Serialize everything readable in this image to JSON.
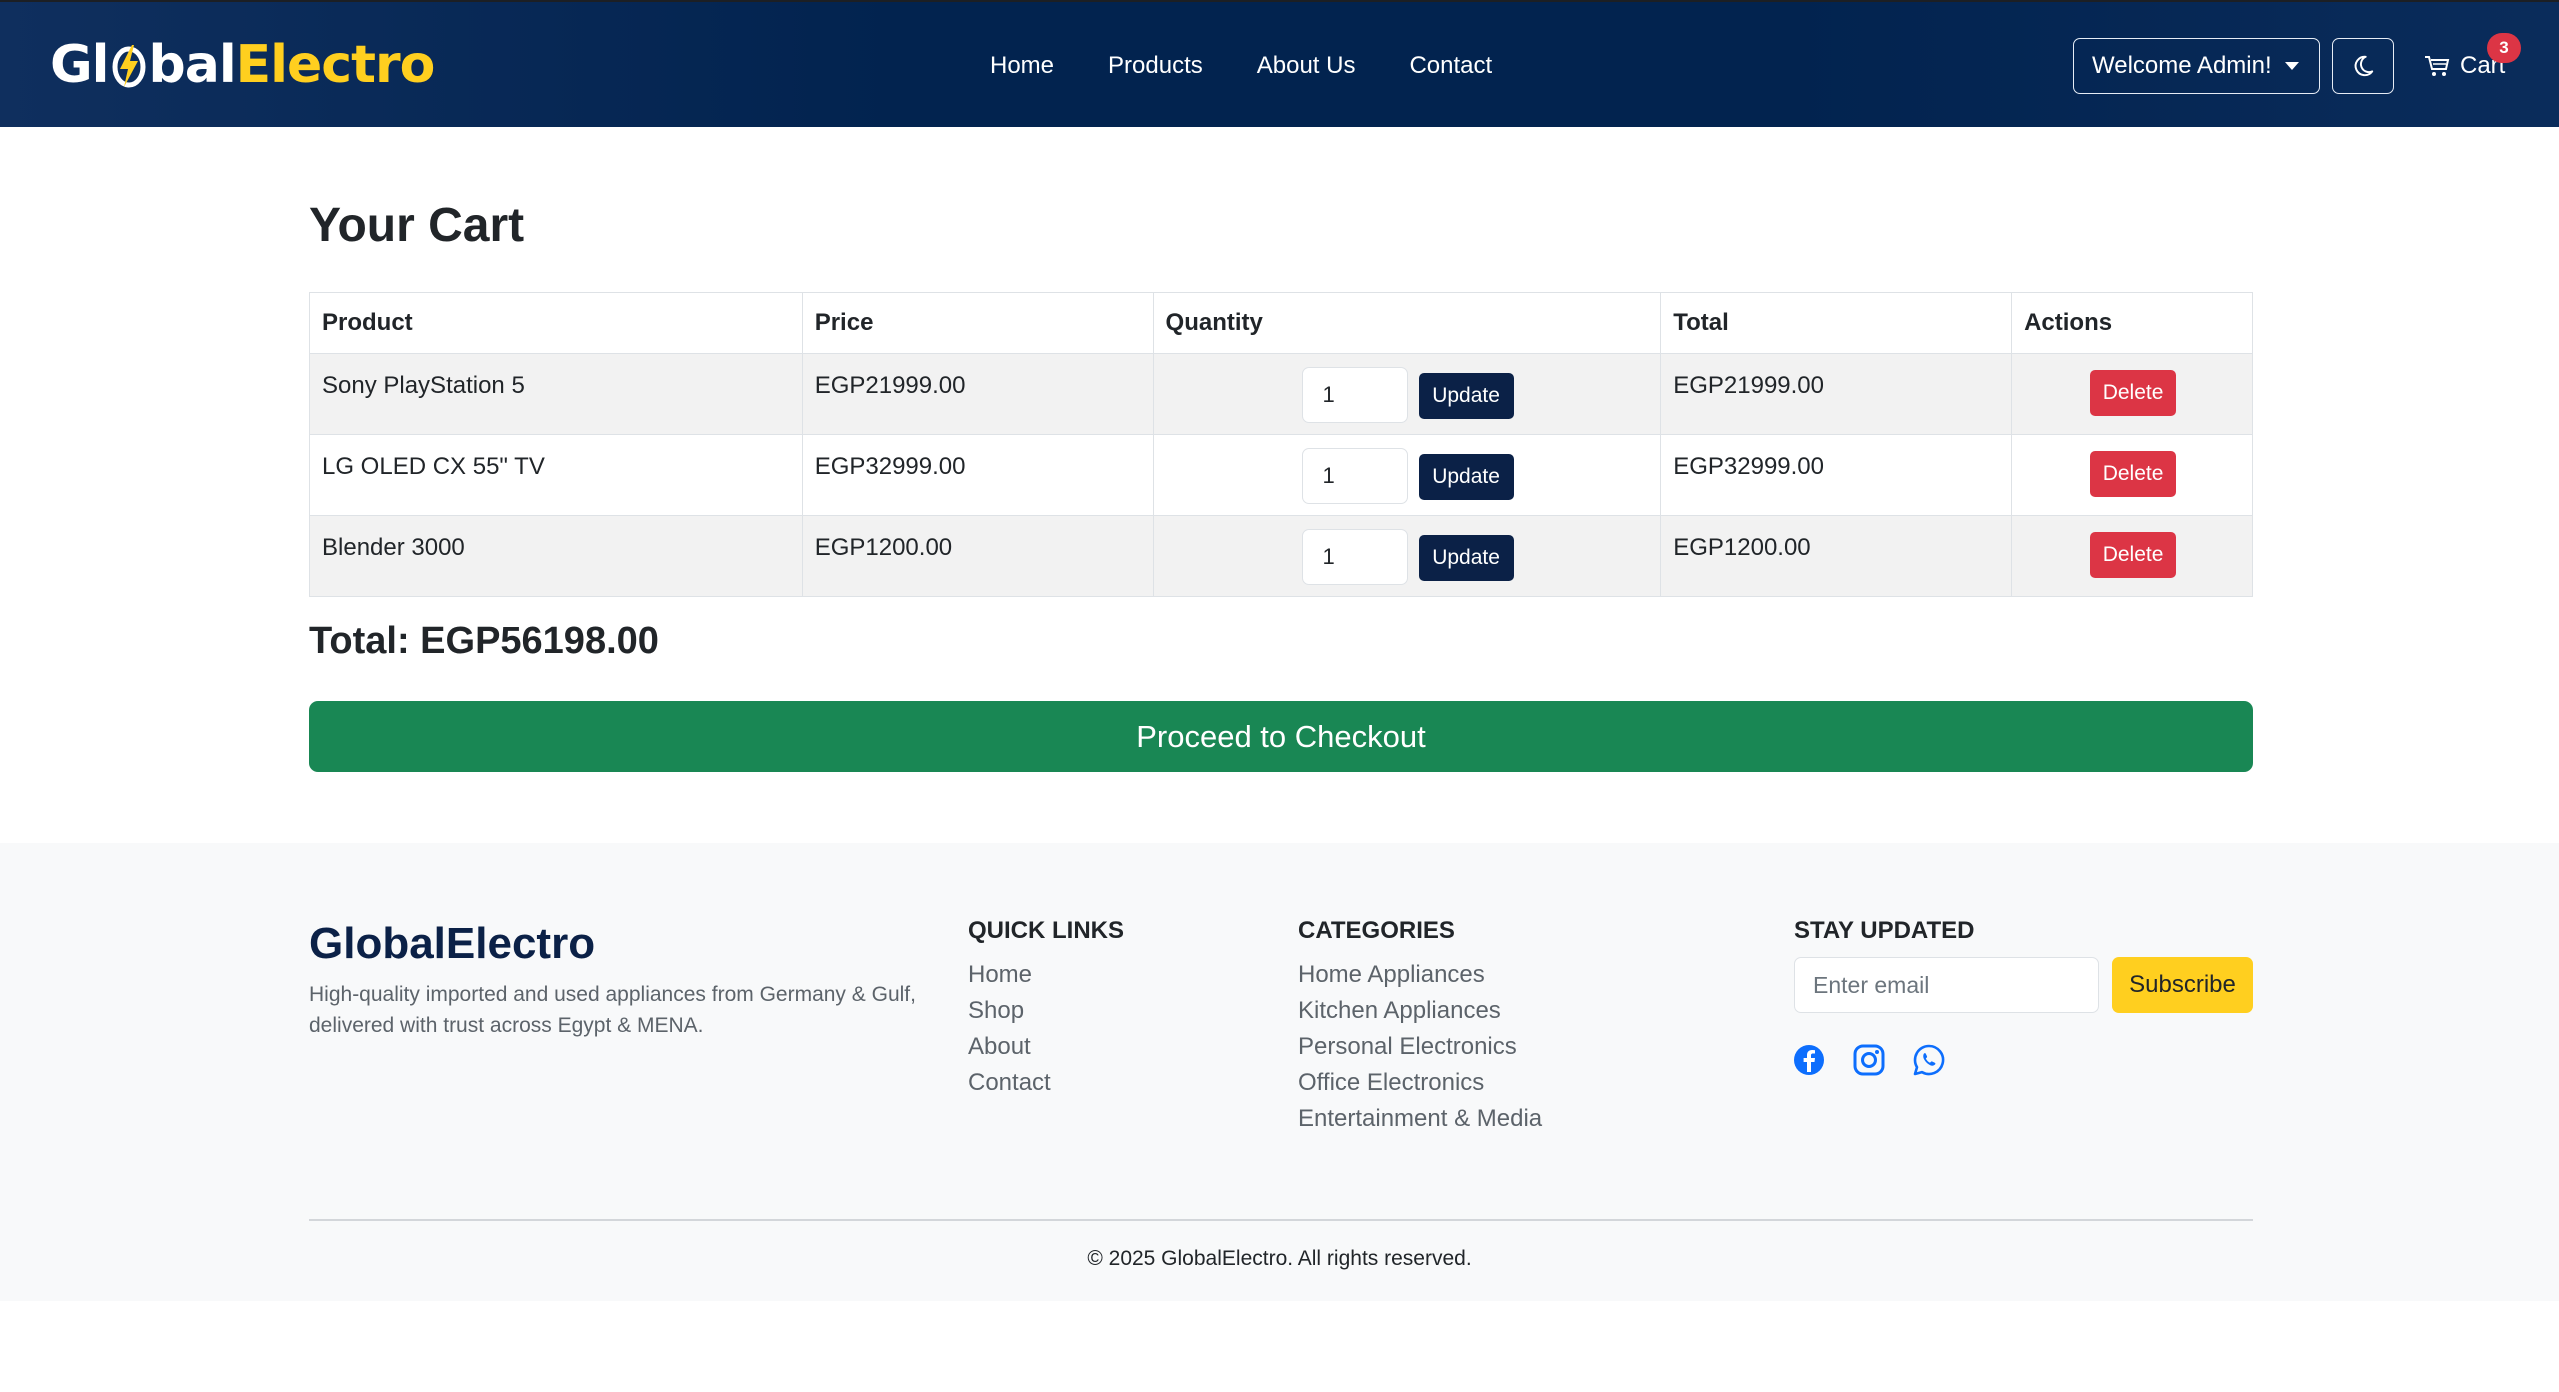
{
  "brand": {
    "part1": "Gl",
    "part2": "bal",
    "part3": "Electro",
    "icon": "lightning-bolt-icon"
  },
  "nav": {
    "links": [
      "Home",
      "Products",
      "About Us",
      "Contact"
    ],
    "welcome_label": "Welcome Admin!",
    "theme_icon": "moon-icon",
    "cart_label": "Cart",
    "cart_count": "3"
  },
  "main": {
    "title": "Your Cart",
    "columns": [
      "Product",
      "Price",
      "Quantity",
      "Total",
      "Actions"
    ],
    "rows": [
      {
        "product": "Sony PlayStation 5",
        "price": "EGP21999.00",
        "qty": "1",
        "total": "EGP21999.00"
      },
      {
        "product": "LG OLED CX 55\" TV",
        "price": "EGP32999.00",
        "qty": "1",
        "total": "EGP32999.00"
      },
      {
        "product": "Blender 3000",
        "price": "EGP1200.00",
        "qty": "1",
        "total": "EGP1200.00"
      }
    ],
    "update_label": "Update",
    "delete_label": "Delete",
    "grand_total": "Total: EGP56198.00",
    "checkout_label": "Proceed to Checkout"
  },
  "footer": {
    "brand": "GlobalElectro",
    "description": "High-quality imported and used appliances from Germany & Gulf, delivered with trust across Egypt & MENA.",
    "quick_links": {
      "heading": "QUICK LINKS",
      "items": [
        "Home",
        "Shop",
        "About",
        "Contact"
      ]
    },
    "categories": {
      "heading": "CATEGORIES",
      "items": [
        "Home Appliances",
        "Kitchen Appliances",
        "Personal Electronics",
        "Office Electronics",
        "Entertainment & Media"
      ]
    },
    "stay_updated": {
      "heading": "STAY UPDATED",
      "email_placeholder": "Enter email",
      "subscribe_label": "Subscribe"
    },
    "social_icons": [
      "facebook-icon",
      "instagram-icon",
      "whatsapp-icon"
    ],
    "copyright": "© 2025 GlobalElectro. All rights reserved."
  },
  "colors": {
    "navy": "#02234f",
    "accent_yellow": "#ffcf1f",
    "success": "#198754",
    "danger": "#dc3545",
    "social_blue": "#0d6efd"
  }
}
